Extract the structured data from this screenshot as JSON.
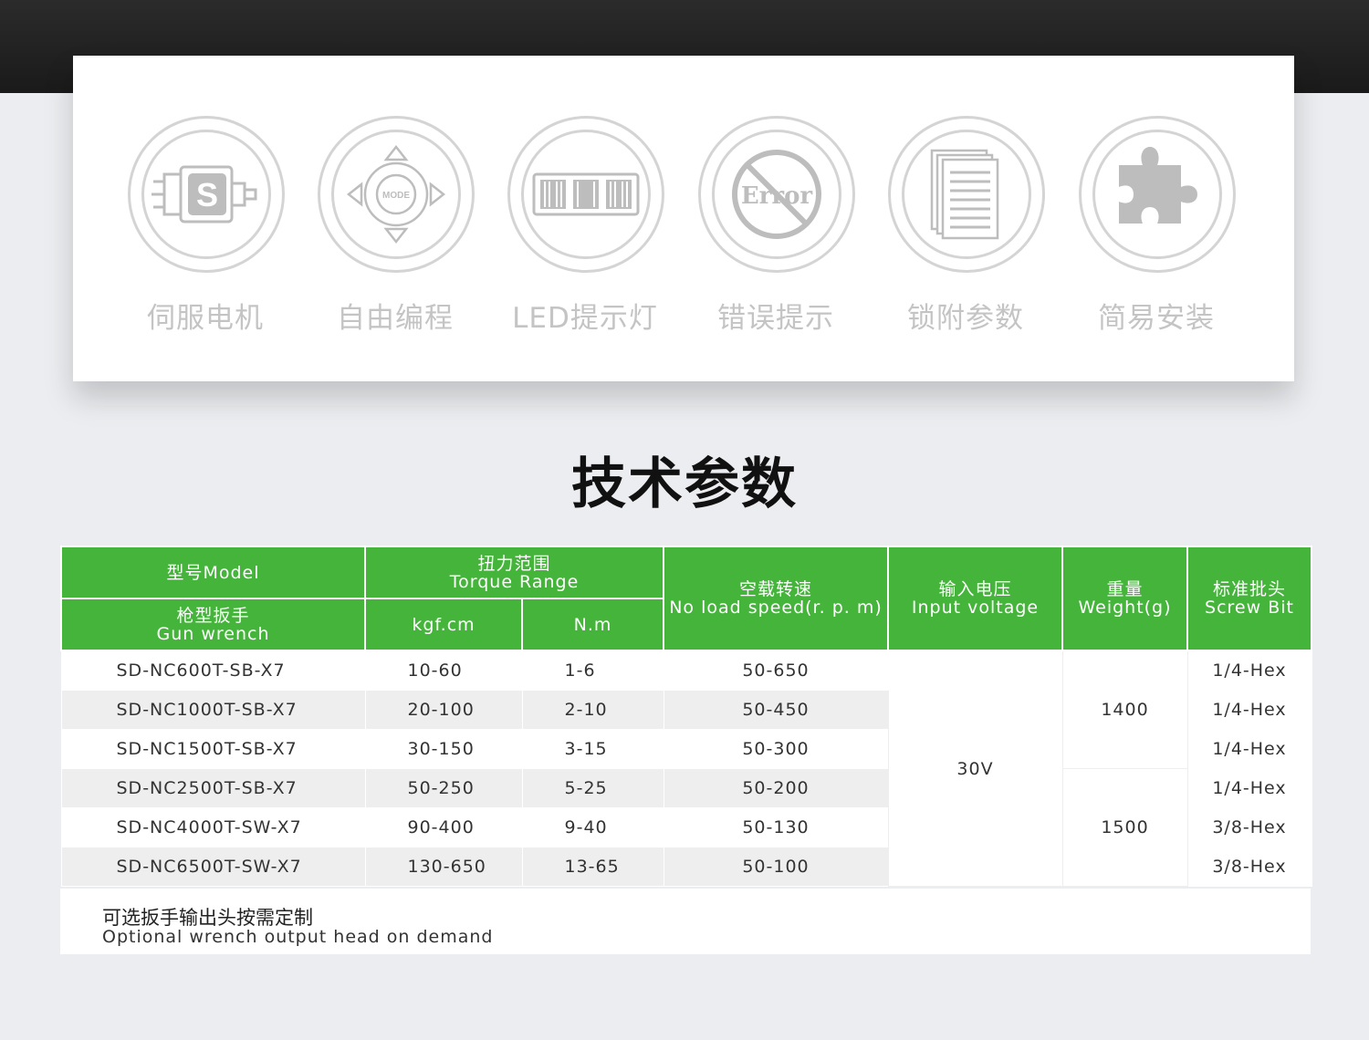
{
  "features": [
    {
      "label": "伺服电机",
      "icon": "servo-motor-icon"
    },
    {
      "label": "自由编程",
      "icon": "mode-dpad-icon"
    },
    {
      "label": "LED提示灯",
      "icon": "led-display-icon"
    },
    {
      "label": "错误提示",
      "icon": "error-no-icon",
      "icon_text": "Error"
    },
    {
      "label": "锁附参数",
      "icon": "document-stack-icon"
    },
    {
      "label": "简易安装",
      "icon": "puzzle-piece-icon"
    }
  ],
  "icon_texts": {
    "servo": "S",
    "mode": "MODE",
    "error": "Error"
  },
  "section_title": "技术参数",
  "table": {
    "headers": {
      "model_cn": "型号Model",
      "model_sub_cn": "枪型扳手",
      "model_sub_en": "Gun wrench",
      "torque_cn": "扭力范围",
      "torque_en": "Torque Range",
      "kgf": "kgf.cm",
      "nm": "N.m",
      "speed_cn": "空载转速",
      "speed_en": "No load speed(r. p. m)",
      "voltage_cn": "输入电压",
      "voltage_en": "Input voltage",
      "weight_cn": "重量",
      "weight_en": "Weight(g)",
      "bit_cn": "标准批头",
      "bit_en": "Screw Bit"
    },
    "rows": [
      {
        "model": "SD-NC600T-SB-X7",
        "kgf": "10-60",
        "nm": "1-6",
        "speed": "50-650",
        "bit": "1/4-Hex"
      },
      {
        "model": "SD-NC1000T-SB-X7",
        "kgf": "20-100",
        "nm": "2-10",
        "speed": "50-450",
        "bit": "1/4-Hex"
      },
      {
        "model": "SD-NC1500T-SB-X7",
        "kgf": "30-150",
        "nm": "3-15",
        "speed": "50-300",
        "bit": "1/4-Hex"
      },
      {
        "model": "SD-NC2500T-SB-X7",
        "kgf": "50-250",
        "nm": "5-25",
        "speed": "50-200",
        "bit": "1/4-Hex"
      },
      {
        "model": "SD-NC4000T-SW-X7",
        "kgf": "90-400",
        "nm": "9-40",
        "speed": "50-130",
        "bit": "3/8-Hex"
      },
      {
        "model": "SD-NC6500T-SW-X7",
        "kgf": "130-650",
        "nm": "13-65",
        "speed": "50-100",
        "bit": "3/8-Hex"
      }
    ],
    "voltage": "30V",
    "weight_group_1": "1400",
    "weight_group_2": "1500"
  },
  "footnote": {
    "cn": "可选扳手输出头按需定制",
    "en": "Optional wrench output head on demand"
  },
  "colors": {
    "header_green": "#45b43b",
    "icon_gray": "#bdbdbd",
    "label_gray": "#c4c4c4"
  }
}
